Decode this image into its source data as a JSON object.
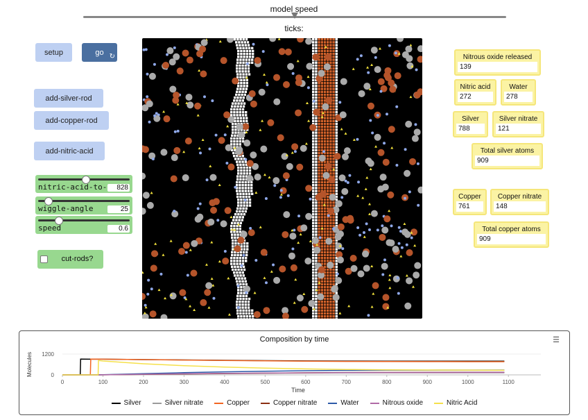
{
  "header": {
    "model_speed_label": "model speed",
    "ticks_label": "ticks:",
    "model_speed_value": 0.5
  },
  "buttons": {
    "setup": "setup",
    "go": "go",
    "go_icon": "forever-repeat-icon",
    "add_silver_rod": "add-silver-rod",
    "add_copper_rod": "add-copper-rod",
    "add_nitric_acid": "add-nitric-acid"
  },
  "sliders": [
    {
      "label": "nitric-acid-to-add",
      "value": "828",
      "fraction": 0.52
    },
    {
      "label": "wiggle-angle",
      "value": "25",
      "fraction": 0.07
    },
    {
      "label": "speed",
      "value": "0.6",
      "fraction": 0.2
    }
  ],
  "switch": {
    "label": "cut-rods?",
    "checked": false
  },
  "monitors": {
    "nitrous_oxide": {
      "label": "Nitrous oxide released",
      "value": "139"
    },
    "nitric_acid": {
      "label": "Nitric acid",
      "value": "272"
    },
    "water": {
      "label": "Water",
      "value": "278"
    },
    "silver": {
      "label": "Silver",
      "value": "788"
    },
    "silver_nitrate": {
      "label": "Silver nitrate",
      "value": "121"
    },
    "total_silver": {
      "label": "Total silver atoms",
      "value": "909"
    },
    "copper": {
      "label": "Copper",
      "value": "761"
    },
    "copper_nitrate": {
      "label": "Copper nitrate",
      "value": "148"
    },
    "total_copper": {
      "label": "Total copper atoms",
      "value": "909"
    }
  },
  "world": {
    "background": "#000000",
    "silver_color": "#ffffff",
    "copper_color": "#d2622a",
    "particle_colors": [
      "#aaaaaa",
      "#b5542a",
      "#8fa8e8",
      "#f2e23c"
    ]
  },
  "plot_menu_icon": "hamburger-menu-icon",
  "chart_data": {
    "type": "line",
    "title": "Composition by time",
    "xlabel": "Time",
    "ylabel": "Molecules",
    "xlim": [
      0,
      1180
    ],
    "ylim": [
      0,
      1200
    ],
    "x_ticks": [
      "0",
      "100",
      "200",
      "300",
      "400",
      "500",
      "600",
      "700",
      "800",
      "900",
      "1000",
      "1100"
    ],
    "y_ticks": [
      "0",
      "1200"
    ],
    "legend_position": "bottom",
    "series": [
      {
        "name": "Silver",
        "color": "#000000",
        "points": [
          [
            0,
            0
          ],
          [
            44,
            0
          ],
          [
            45,
            909
          ],
          [
            100,
            905
          ],
          [
            200,
            880
          ],
          [
            300,
            860
          ],
          [
            400,
            840
          ],
          [
            500,
            820
          ],
          [
            600,
            805
          ],
          [
            700,
            795
          ],
          [
            800,
            790
          ],
          [
            900,
            789
          ],
          [
            1000,
            788
          ],
          [
            1090,
            788
          ]
        ]
      },
      {
        "name": "Silver nitrate",
        "color": "#9a9a9a",
        "points": [
          [
            0,
            0
          ],
          [
            44,
            0
          ],
          [
            45,
            0
          ],
          [
            100,
            4
          ],
          [
            200,
            29
          ],
          [
            300,
            49
          ],
          [
            400,
            69
          ],
          [
            500,
            89
          ],
          [
            600,
            104
          ],
          [
            700,
            114
          ],
          [
            800,
            119
          ],
          [
            900,
            120
          ],
          [
            1000,
            121
          ],
          [
            1090,
            121
          ]
        ]
      },
      {
        "name": "Copper",
        "color": "#f26522",
        "points": [
          [
            0,
            0
          ],
          [
            69,
            0
          ],
          [
            70,
            909
          ],
          [
            100,
            905
          ],
          [
            200,
            880
          ],
          [
            300,
            855
          ],
          [
            400,
            830
          ],
          [
            500,
            810
          ],
          [
            600,
            790
          ],
          [
            700,
            775
          ],
          [
            800,
            768
          ],
          [
            900,
            764
          ],
          [
            1000,
            762
          ],
          [
            1090,
            761
          ]
        ]
      },
      {
        "name": "Copper nitrate",
        "color": "#8b2e12",
        "points": [
          [
            0,
            0
          ],
          [
            69,
            0
          ],
          [
            70,
            0
          ],
          [
            100,
            4
          ],
          [
            200,
            29
          ],
          [
            300,
            54
          ],
          [
            400,
            79
          ],
          [
            500,
            99
          ],
          [
            600,
            119
          ],
          [
            700,
            134
          ],
          [
            800,
            141
          ],
          [
            900,
            145
          ],
          [
            1000,
            147
          ],
          [
            1090,
            148
          ]
        ]
      },
      {
        "name": "Water",
        "color": "#2d5aa8",
        "points": [
          [
            0,
            0
          ],
          [
            89,
            0
          ],
          [
            100,
            10
          ],
          [
            200,
            70
          ],
          [
            300,
            130
          ],
          [
            400,
            175
          ],
          [
            500,
            210
          ],
          [
            600,
            240
          ],
          [
            700,
            258
          ],
          [
            800,
            268
          ],
          [
            900,
            273
          ],
          [
            1000,
            276
          ],
          [
            1090,
            278
          ]
        ]
      },
      {
        "name": "Nitrous oxide",
        "color": "#b06aa6",
        "points": [
          [
            0,
            0
          ],
          [
            89,
            0
          ],
          [
            100,
            5
          ],
          [
            200,
            35
          ],
          [
            300,
            65
          ],
          [
            400,
            88
          ],
          [
            500,
            105
          ],
          [
            600,
            120
          ],
          [
            700,
            129
          ],
          [
            800,
            134
          ],
          [
            900,
            136
          ],
          [
            1000,
            138
          ],
          [
            1090,
            139
          ]
        ]
      },
      {
        "name": "Nitric Acid",
        "color": "#f5e04a",
        "points": [
          [
            0,
            0
          ],
          [
            88,
            0
          ],
          [
            89,
            828
          ],
          [
            100,
            800
          ],
          [
            200,
            640
          ],
          [
            300,
            530
          ],
          [
            400,
            450
          ],
          [
            500,
            390
          ],
          [
            600,
            345
          ],
          [
            700,
            312
          ],
          [
            800,
            292
          ],
          [
            900,
            282
          ],
          [
            1000,
            276
          ],
          [
            1090,
            272
          ]
        ]
      }
    ]
  }
}
